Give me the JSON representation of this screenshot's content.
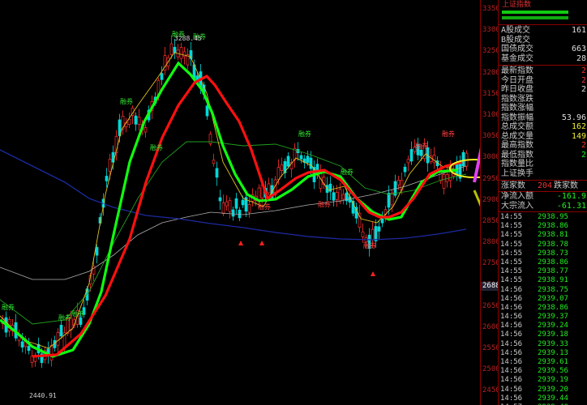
{
  "axis": {
    "ticks": [
      "3350",
      "3300",
      "3250",
      "3200",
      "3150",
      "3100",
      "3050",
      "3000",
      "2950",
      "2900",
      "2850",
      "2800",
      "2750",
      "2700",
      "2650",
      "2600",
      "2550",
      "2500",
      "2450"
    ],
    "current_price": "2688.3"
  },
  "chart": {
    "high_label": "3288.45",
    "low_label": "2440.91",
    "signal_labels": [
      "融券",
      "融券",
      "融券",
      "融券",
      "融券",
      "融券",
      "融券",
      "融券",
      "融券",
      "融券",
      "融券",
      "融券",
      "融券",
      "融券"
    ]
  },
  "panel": {
    "title": "上证指数",
    "stats": [
      {
        "label": "A股成交",
        "value": "161",
        "color": "#ddd"
      },
      {
        "label": "B股成交",
        "value": "",
        "color": "#ddd"
      },
      {
        "label": "国债成交",
        "value": "663",
        "color": "#ddd"
      },
      {
        "label": "基金成交",
        "value": "28",
        "color": "#ddd"
      }
    ],
    "index": [
      {
        "label": "最新指数",
        "value": "2",
        "color": "#e33"
      },
      {
        "label": "今日开盘",
        "value": "2",
        "color": "#e33"
      },
      {
        "label": "昨日收盘",
        "value": "2",
        "color": "#ddd"
      },
      {
        "label": "指数涨跌",
        "value": "",
        "color": "#ddd"
      },
      {
        "label": "指数涨幅",
        "value": "",
        "color": "#ddd"
      },
      {
        "label": "指数振幅",
        "value": "53.96",
        "color": "#ddd"
      },
      {
        "label": "总成交额",
        "value": "162",
        "color": "#ee3"
      },
      {
        "label": "总成交量",
        "value": "149",
        "color": "#ee3"
      },
      {
        "label": "最高指数",
        "value": "2",
        "color": "#e33"
      },
      {
        "label": "最低指数",
        "value": "2",
        "color": "#2e2"
      },
      {
        "label": "指数量比",
        "value": "",
        "color": "#ddd"
      },
      {
        "label": "上证换手",
        "value": "",
        "color": "#ddd"
      }
    ],
    "advance": {
      "up_label": "涨家数",
      "up_value": "204",
      "down_label": "跌家数"
    },
    "flows": [
      {
        "label": "净流入额",
        "value": "-161.9",
        "color": "#2e2"
      },
      {
        "label": "大宗流入",
        "value": "-61.31",
        "color": "#2e2"
      }
    ],
    "trades": [
      {
        "time": "14:55",
        "price": "2938.95"
      },
      {
        "time": "14:55",
        "price": "2938.86"
      },
      {
        "time": "14:55",
        "price": "2938.81"
      },
      {
        "time": "14:55",
        "price": "2938.78"
      },
      {
        "time": "14:55",
        "price": "2938.73"
      },
      {
        "time": "14:55",
        "price": "2938.86"
      },
      {
        "time": "14:55",
        "price": "2938.77"
      },
      {
        "time": "14:55",
        "price": "2938.91"
      },
      {
        "time": "14:56",
        "price": "2938.75"
      },
      {
        "time": "14:56",
        "price": "2939.07"
      },
      {
        "time": "14:56",
        "price": "2938.86"
      },
      {
        "time": "14:56",
        "price": "2939.37"
      },
      {
        "time": "14:56",
        "price": "2939.24"
      },
      {
        "time": "14:56",
        "price": "2939.18"
      },
      {
        "time": "14:56",
        "price": "2939.33"
      },
      {
        "time": "14:56",
        "price": "2939.13"
      },
      {
        "time": "14:56",
        "price": "2939.61"
      },
      {
        "time": "14:56",
        "price": "2939.56"
      },
      {
        "time": "14:56",
        "price": "2939.19"
      },
      {
        "time": "14:56",
        "price": "2939.20"
      },
      {
        "time": "14:56",
        "price": "2939.44"
      },
      {
        "time": "14:57",
        "price": "2939.40"
      }
    ]
  },
  "colors": {
    "up": "#ff3030",
    "down": "#00d8d8",
    "ma_red": "#ff1010",
    "ma_green": "#10ff10",
    "ma_yellow": "#e0c020",
    "ma_dkgreen": "#20a020",
    "ma_blue": "#1c2aa0",
    "ma_gray": "#b0b0b0",
    "arrow_magenta": "#e040f0",
    "arrow_olive": "#b8c000",
    "ellipse": "#f0f020"
  }
}
